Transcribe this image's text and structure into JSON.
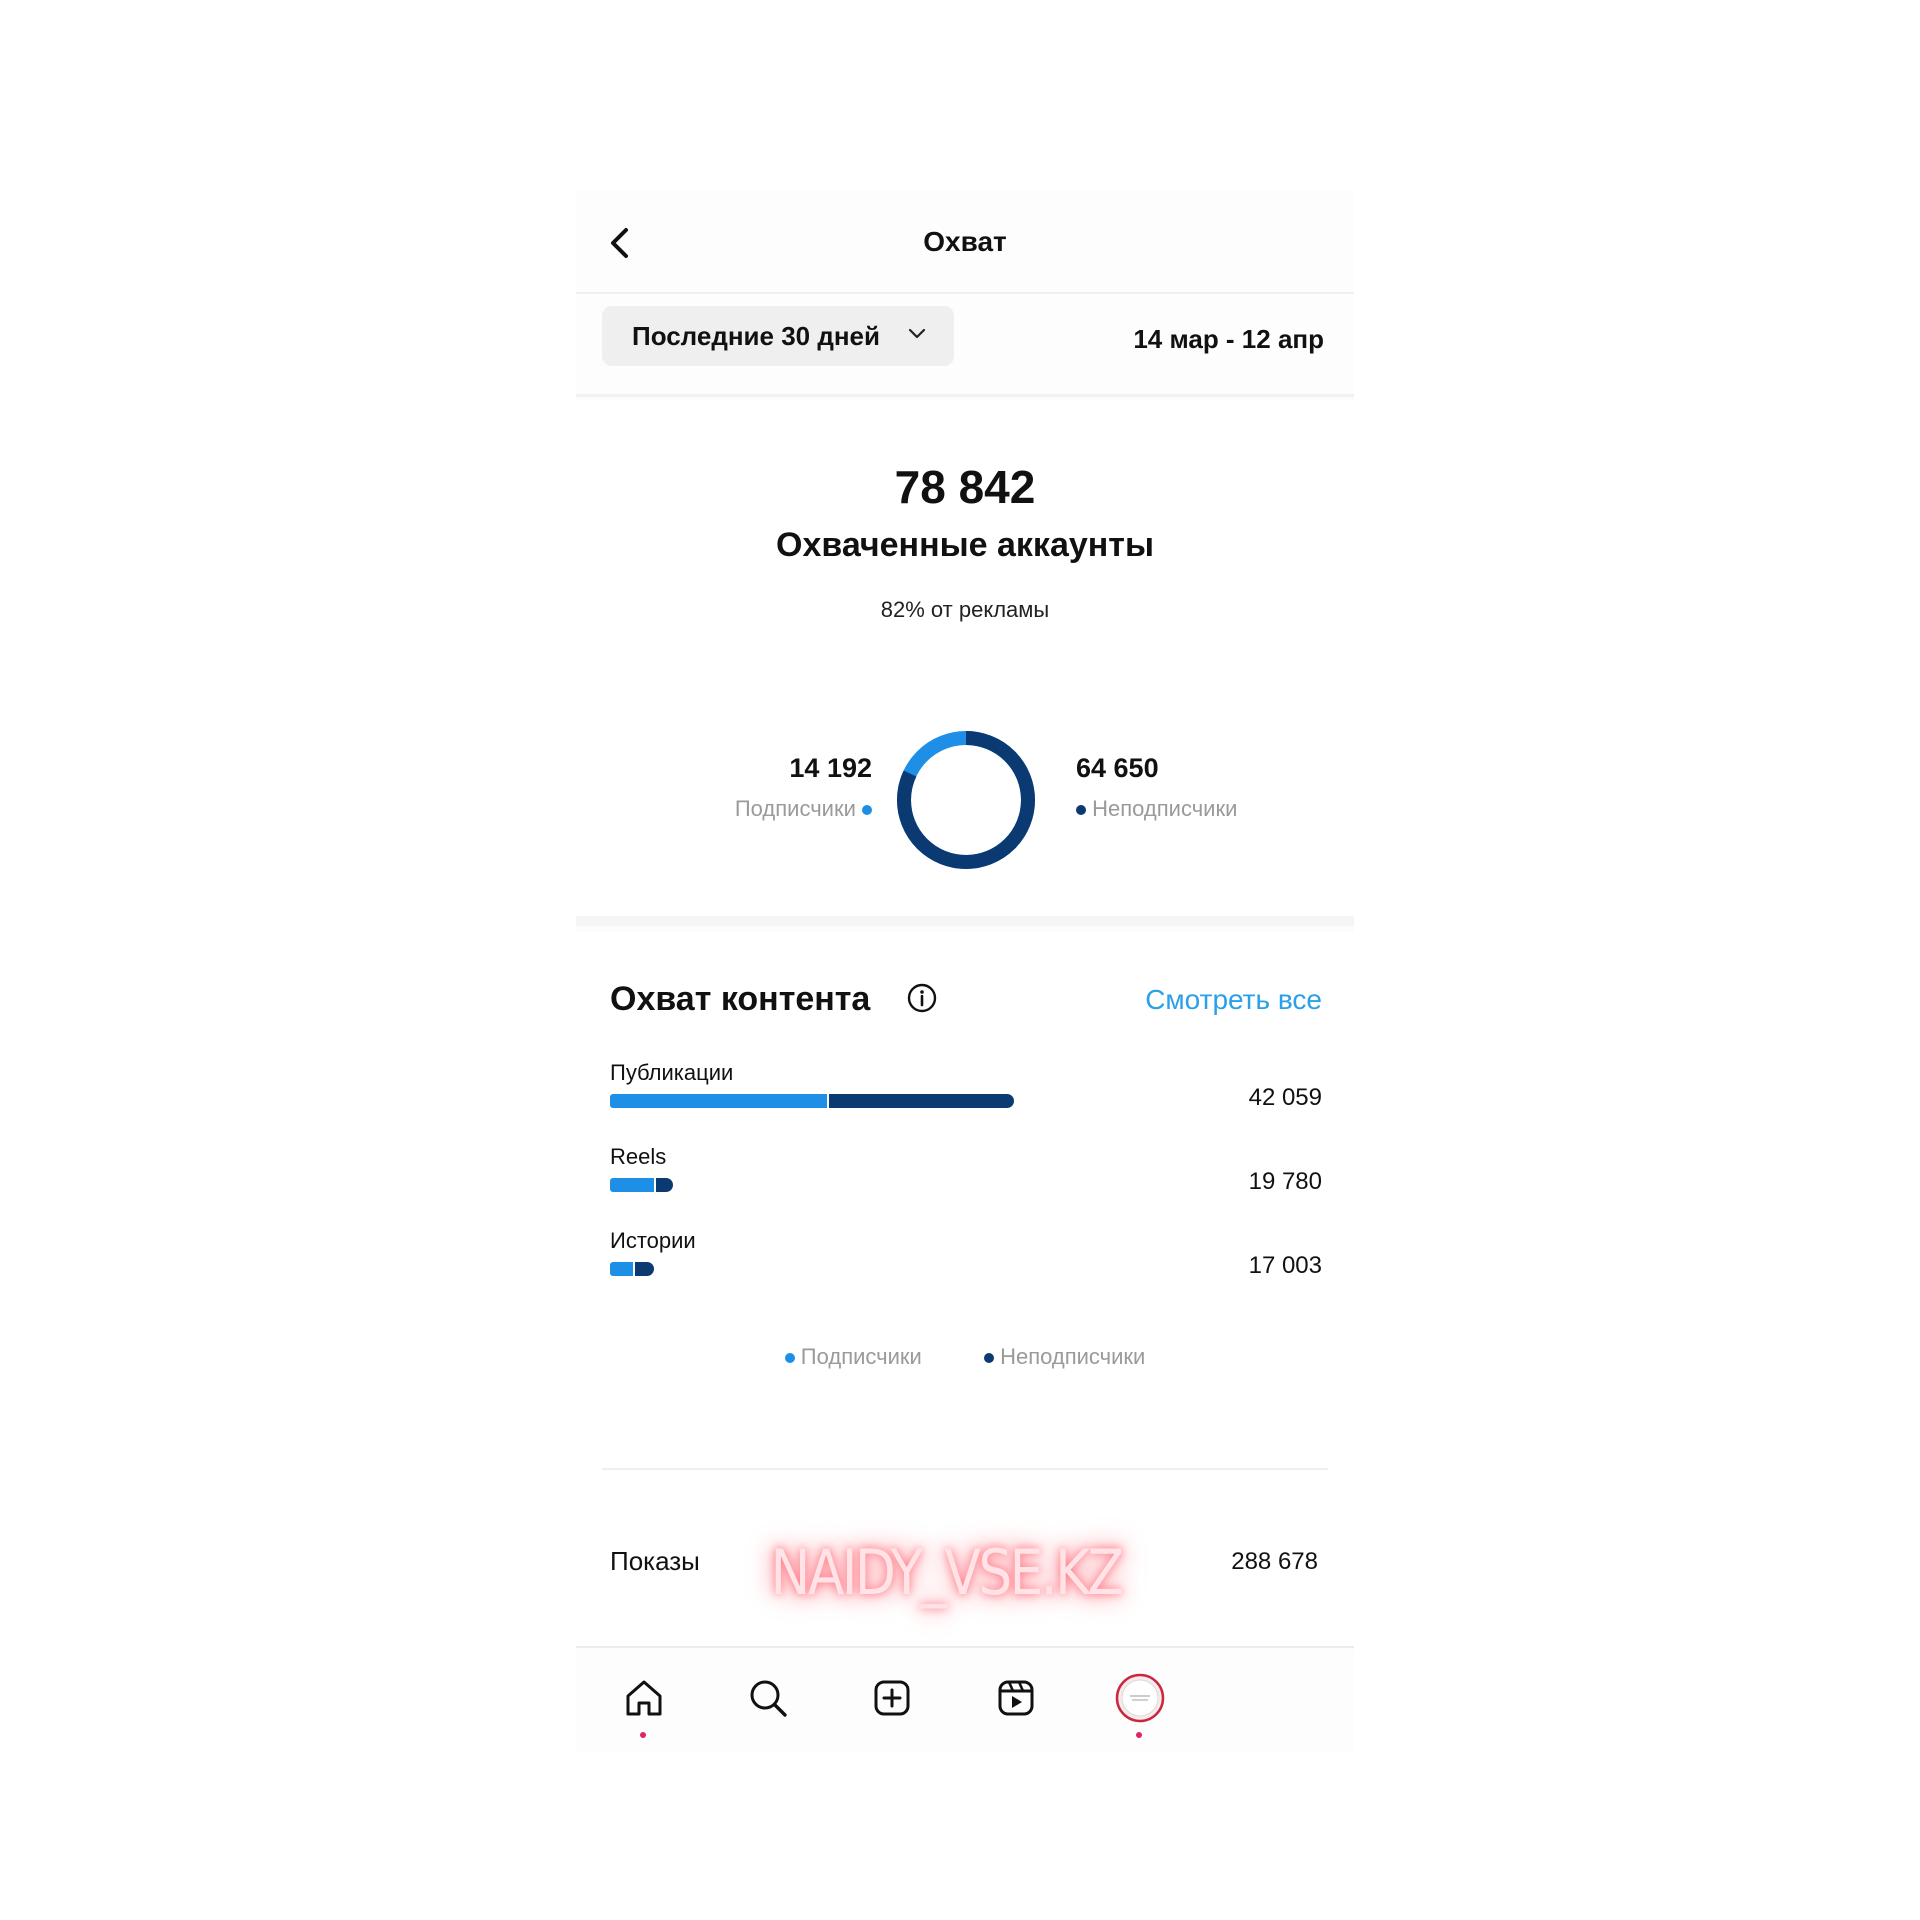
{
  "header": {
    "title": "Охват",
    "back_icon": "chevron-left-icon"
  },
  "filter": {
    "period_label": "Последние 30 дней",
    "period_icon": "chevron-down-icon",
    "date_range": "14 мар - 12 апр"
  },
  "summary": {
    "total": "78 842",
    "total_label": "Охваченные аккаунты",
    "ads_note": "82% от рекламы",
    "followers_value": "14 192",
    "followers_label": "Подписчики",
    "nonfollowers_value": "64 650",
    "nonfollowers_label": "Неподписчики",
    "donut": {
      "followers": 14192,
      "nonfollowers": 64650
    }
  },
  "content_reach": {
    "title": "Охват контента",
    "info_icon": "info-icon",
    "see_all": "Смотреть все",
    "rows": [
      {
        "label": "Публикации",
        "value": "42 059",
        "total": 42059,
        "followers_fraction": 0.54
      },
      {
        "label": "Reels",
        "value": "19 780",
        "total": 19780,
        "followers_fraction": 0.72
      },
      {
        "label": "Истории",
        "value": "17 003",
        "total": 17003,
        "followers_fraction": 0.55
      }
    ],
    "legend_followers": "Подписчики",
    "legend_nonfollowers": "Неподписчики"
  },
  "impressions": {
    "label": "Показы",
    "value": "288 678"
  },
  "watermark": "NAIDY_VSE.KZ",
  "nav": {
    "items": [
      "home-icon",
      "search-icon",
      "add-post-icon",
      "reels-icon",
      "profile-avatar"
    ]
  },
  "colors": {
    "followers": "#1d8fe6",
    "nonfollowers": "#0b3a73",
    "link": "#2aa0e8",
    "notification_dot": "#e0245e"
  }
}
